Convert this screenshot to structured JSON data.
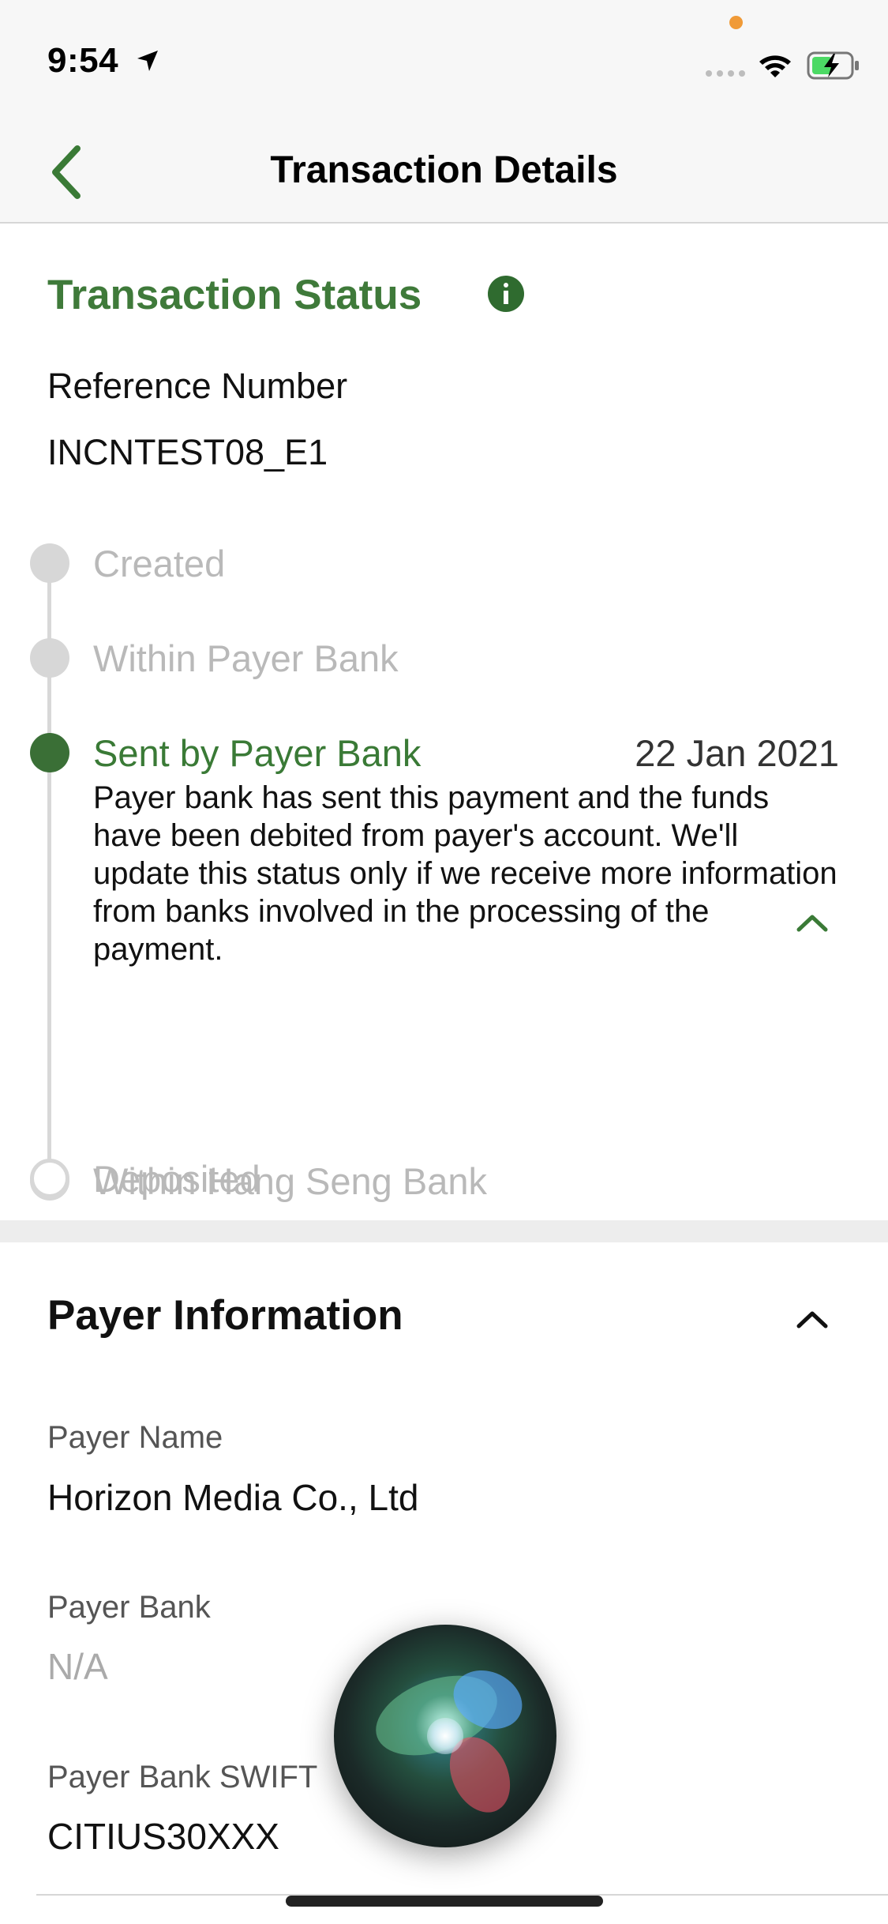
{
  "status_bar": {
    "time": "9:54"
  },
  "nav": {
    "title": "Transaction Details"
  },
  "transaction_status": {
    "title": "Transaction Status",
    "reference_label": "Reference Number",
    "reference_value": "INCNTEST08_E1",
    "steps": [
      {
        "label": "Created",
        "state": "completed"
      },
      {
        "label": "Within Payer Bank",
        "state": "completed"
      },
      {
        "label": "Sent by Payer Bank",
        "state": "current",
        "date": "22 Jan 2021",
        "description": "Payer bank has sent this payment and the funds have been debited from payer's account. We'll update this status only if we receive more information from banks involved in the processing of the payment."
      },
      {
        "label": "Within Hang Seng Bank",
        "state": "pending"
      },
      {
        "label": "Deposited",
        "state": "pending"
      }
    ]
  },
  "payer_information": {
    "title": "Payer Information",
    "fields": [
      {
        "label": "Payer Name",
        "value": "Horizon Media Co., Ltd"
      },
      {
        "label": "Payer Bank",
        "value": "N/A"
      },
      {
        "label": "Payer Bank SWIFT",
        "value": "CITIUS30XXX"
      }
    ]
  },
  "colors": {
    "accent_green": "#3f7a3a",
    "dark_green": "#2f6b2f",
    "inactive_grey": "#b9b9b9"
  }
}
